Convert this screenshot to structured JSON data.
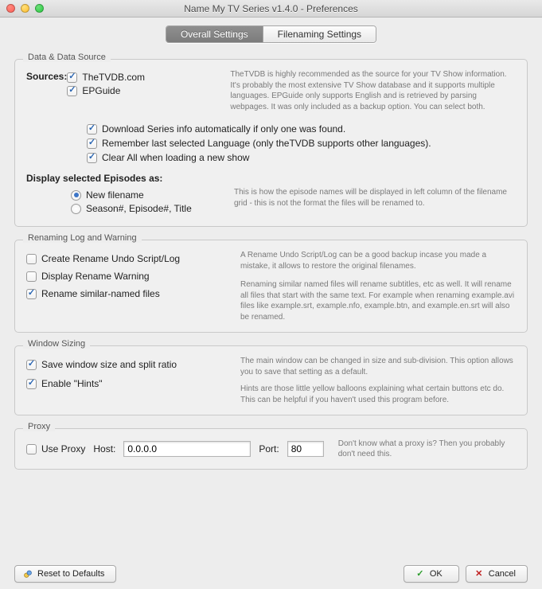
{
  "window": {
    "title": "Name My TV Series v1.4.0 - Preferences"
  },
  "tabs": {
    "overall": "Overall Settings",
    "filenaming": "Filenaming Settings"
  },
  "groups": {
    "data_source": {
      "legend": "Data & Data Source",
      "sources_label": "Sources:",
      "thetvdb_label": "TheTVDB.com",
      "epguide_label": "EPGuide",
      "source_desc": "TheTVDB is highly recommended as the source for your TV Show information.  It's probably the most extensive TV Show database and it supports multiple  languages. EPGuide only supports English and is retrieved by parsing  webpages. It was only included as a backup option. You can select both.",
      "opt_download": "Download Series info automatically if only one was found.",
      "opt_remember_lang": "Remember last selected Language (only theTVDB supports other languages).",
      "opt_clear_all": "Clear All when loading a new show",
      "display_as_label": "Display selected Episodes as:",
      "radio_new_filename": "New filename",
      "radio_season_ep_title": "Season#, Episode#, Title",
      "display_as_desc": "This is how the episode names will be displayed in left column of the filename grid - this is not the format the files will be renamed to."
    },
    "renaming": {
      "legend": "Renaming Log and Warning",
      "create_undo": "Create Rename Undo Script/Log",
      "display_warning": "Display Rename Warning",
      "rename_similar": "Rename similar-named files",
      "desc1": "A Rename Undo Script/Log can be a good backup incase you made a mistake, it allows to restore the original filenames.",
      "desc2": "Renaming similar named files will rename subtitles, etc as well. It will rename all files that start with the same text. For example when renaming example.avi files like example.srt, example.nfo, example.btn, and example.en.srt will also be renamed."
    },
    "window_sizing": {
      "legend": "Window Sizing",
      "save_size": "Save window size and split ratio",
      "enable_hints": "Enable \"Hints\"",
      "desc1": "The main window can be changed in size and sub-division. This option allows you to save that setting as a default.",
      "desc2": "Hints are those little yellow balloons explaining what certain buttons etc do. This can be helpful if you haven't used this program before."
    },
    "proxy": {
      "legend": "Proxy",
      "use_proxy": "Use Proxy",
      "host_label": "Host:",
      "host_value": "0.0.0.0",
      "port_label": "Port:",
      "port_value": "80",
      "desc": "Don't know what a proxy is? Then you probably don't need this."
    }
  },
  "footer": {
    "reset": "Reset to Defaults",
    "ok": "OK",
    "cancel": "Cancel"
  },
  "state": {
    "thetvdb_checked": true,
    "epguide_checked": true,
    "download_checked": true,
    "remember_lang_checked": true,
    "clear_all_checked": true,
    "display_radio": "new_filename",
    "create_undo_checked": false,
    "display_warning_checked": false,
    "rename_similar_checked": true,
    "save_size_checked": true,
    "enable_hints_checked": true,
    "use_proxy_checked": false
  }
}
